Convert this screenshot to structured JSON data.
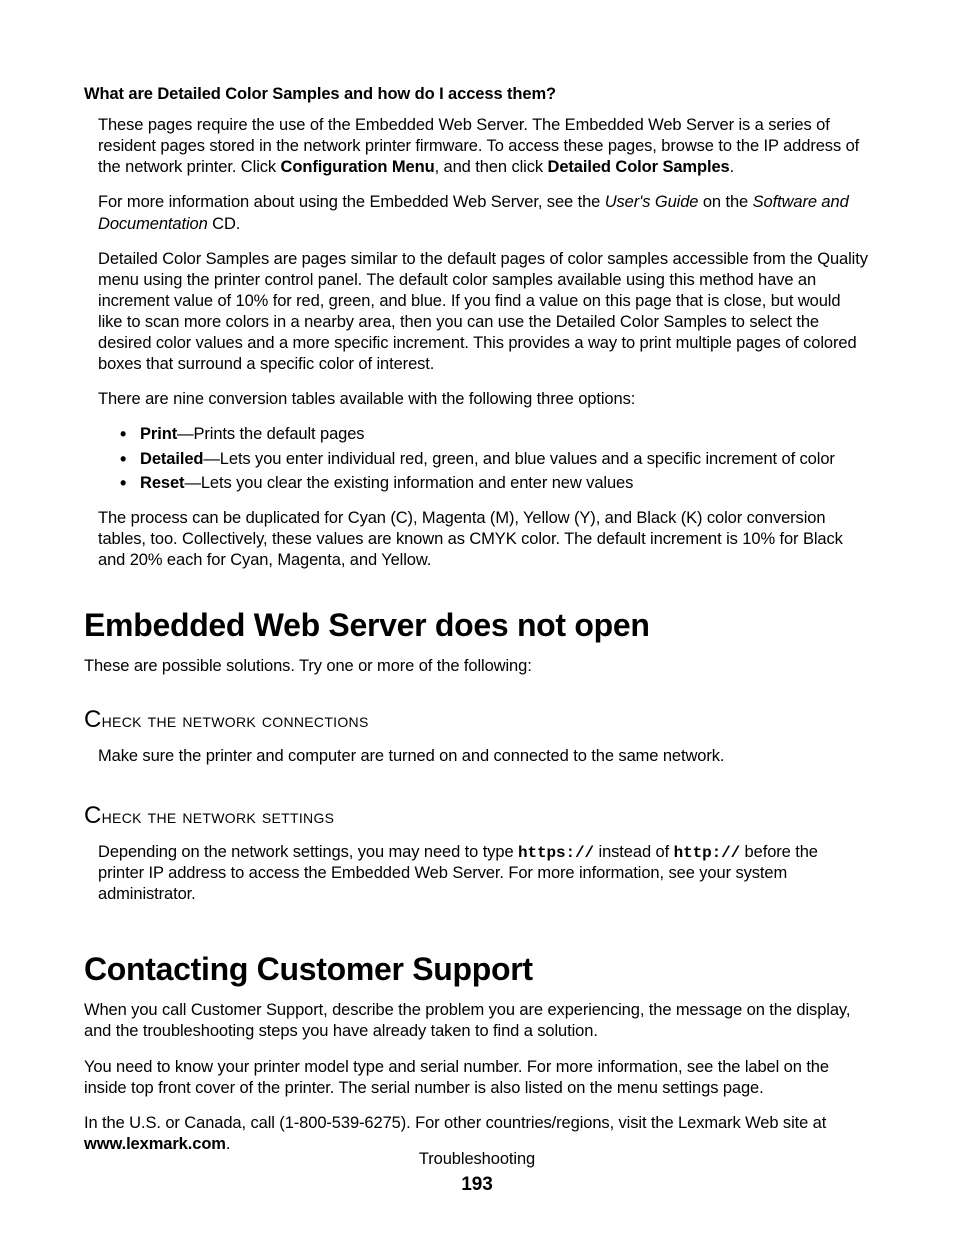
{
  "faq": {
    "question": "What are Detailed Color Samples and how do I access them?",
    "p1_pre": "These pages require the use of the Embedded Web Server. The Embedded Web Server is a series of resident pages stored in the network printer firmware. To access these pages, browse to the IP address of the network printer. Click ",
    "p1_b1": "Configuration Menu",
    "p1_mid": ", and then click ",
    "p1_b2": "Detailed Color Samples",
    "p1_end": ".",
    "p2_pre": "For more information about using the Embedded Web Server, see the ",
    "p2_i1": "User's Guide",
    "p2_mid": " on the ",
    "p2_i2": "Software and Documentation",
    "p2_end": " CD.",
    "p3": "Detailed Color Samples are pages similar to the default pages of color samples accessible from the Quality menu using the printer control panel. The default color samples available using this method have an increment value of 10% for red, green, and blue. If you find a value on this page that is close, but would like to scan more colors in a nearby area, then you can use the Detailed Color Samples to select the desired color values and a more specific increment. This provides a way to print multiple pages of colored boxes that surround a specific color of interest.",
    "p4": "There are nine conversion tables available with the following three options:",
    "bullets": [
      {
        "term": "Print",
        "desc": "—Prints the default pages"
      },
      {
        "term": "Detailed",
        "desc": "—Lets you enter individual red, green, and blue values and a specific increment of color"
      },
      {
        "term": "Reset",
        "desc": "—Lets you clear the existing information and enter new values"
      }
    ],
    "p5": "The process can be duplicated for Cyan (C), Magenta (M), Yellow (Y), and Black (K) color conversion tables, too. Collectively, these values are known as CMYK color. The default increment is 10% for Black and 20% each for Cyan, Magenta, and Yellow."
  },
  "ews": {
    "heading": "Embedded Web Server does not open",
    "lead": "These are possible solutions. Try one or more of the following:",
    "sub1": {
      "first": "C",
      "rest": "heck the network connections"
    },
    "sub1_body": "Make sure the printer and computer are turned on and connected to the same network.",
    "sub2": {
      "first": "C",
      "rest": "heck the network settings"
    },
    "sub2_body_pre": "Depending on the network settings, you may need to type ",
    "sub2_code1": "https://",
    "sub2_body_mid": " instead of ",
    "sub2_code2": "http://",
    "sub2_body_end": " before the printer IP address to access the Embedded Web Server. For more information, see your system administrator."
  },
  "contact": {
    "heading": "Contacting Customer Support",
    "p1": "When you call Customer Support, describe the problem you are experiencing, the message on the display, and the troubleshooting steps you have already taken to find a solution.",
    "p2": "You need to know your printer model type and serial number. For more information, see the label on the inside top front cover of the printer. The serial number is also listed on the menu settings page.",
    "p3_pre": "In the U.S. or Canada, call (1-800-539-6275). For other countries/regions, visit the Lexmark Web site at ",
    "p3_b": "www.lexmark.com",
    "p3_end": "."
  },
  "footer": {
    "title": "Troubleshooting",
    "page": "193"
  }
}
